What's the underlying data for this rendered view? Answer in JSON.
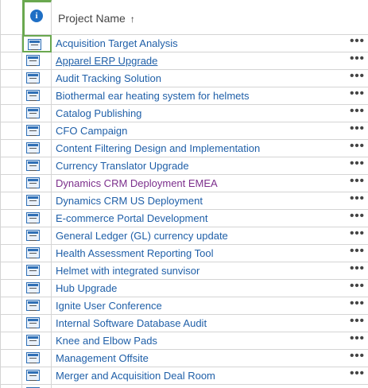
{
  "header": {
    "info_icon": "info-icon",
    "column_title": "Project Name",
    "sort_indicator": "↑"
  },
  "rows": [
    {
      "name": "Acquisition Target Analysis",
      "icon": "project-icon",
      "more": "•••"
    },
    {
      "name": "Apparel ERP Upgrade",
      "icon": "project-icon",
      "more": "•••"
    },
    {
      "name": "Audit Tracking Solution",
      "icon": "project-icon",
      "more": "•••"
    },
    {
      "name": "Biothermal ear heating system for helmets",
      "icon": "project-icon",
      "more": "•••"
    },
    {
      "name": "Catalog Publishing",
      "icon": "project-icon",
      "more": "•••"
    },
    {
      "name": "CFO Campaign",
      "icon": "project-icon",
      "more": "•••"
    },
    {
      "name": "Content Filtering Design and Implementation",
      "icon": "project-icon",
      "more": "•••"
    },
    {
      "name": "Currency Translator Upgrade",
      "icon": "project-icon",
      "more": "•••"
    },
    {
      "name": "Dynamics CRM Deployment EMEA",
      "icon": "project-icon",
      "more": "•••"
    },
    {
      "name": "Dynamics CRM US Deployment",
      "icon": "project-icon",
      "more": "•••"
    },
    {
      "name": "E-commerce Portal Development",
      "icon": "project-icon",
      "more": "•••"
    },
    {
      "name": "General Ledger (GL) currency update",
      "icon": "project-icon",
      "more": "•••"
    },
    {
      "name": "Health Assessment Reporting Tool",
      "icon": "project-icon",
      "more": "•••"
    },
    {
      "name": "Helmet with integrated sunvisor",
      "icon": "project-icon",
      "more": "•••"
    },
    {
      "name": "Hub Upgrade",
      "icon": "project-icon",
      "more": "•••"
    },
    {
      "name": "Ignite User Conference",
      "icon": "project-icon",
      "more": "•••"
    },
    {
      "name": "Internal Software Database Audit",
      "icon": "project-icon",
      "more": "•••"
    },
    {
      "name": "Knee and Elbow Pads",
      "icon": "project-icon",
      "more": "•••"
    },
    {
      "name": "Management Offsite",
      "icon": "project-icon",
      "more": "•••"
    },
    {
      "name": "Merger and Acquisition Deal Room",
      "icon": "project-icon",
      "more": "•••"
    }
  ],
  "colors": {
    "link": "#1f5fa8",
    "visited_link": "#7c2f8c",
    "focus_border": "#6aa84f",
    "grid_line": "#d4d4d4"
  }
}
